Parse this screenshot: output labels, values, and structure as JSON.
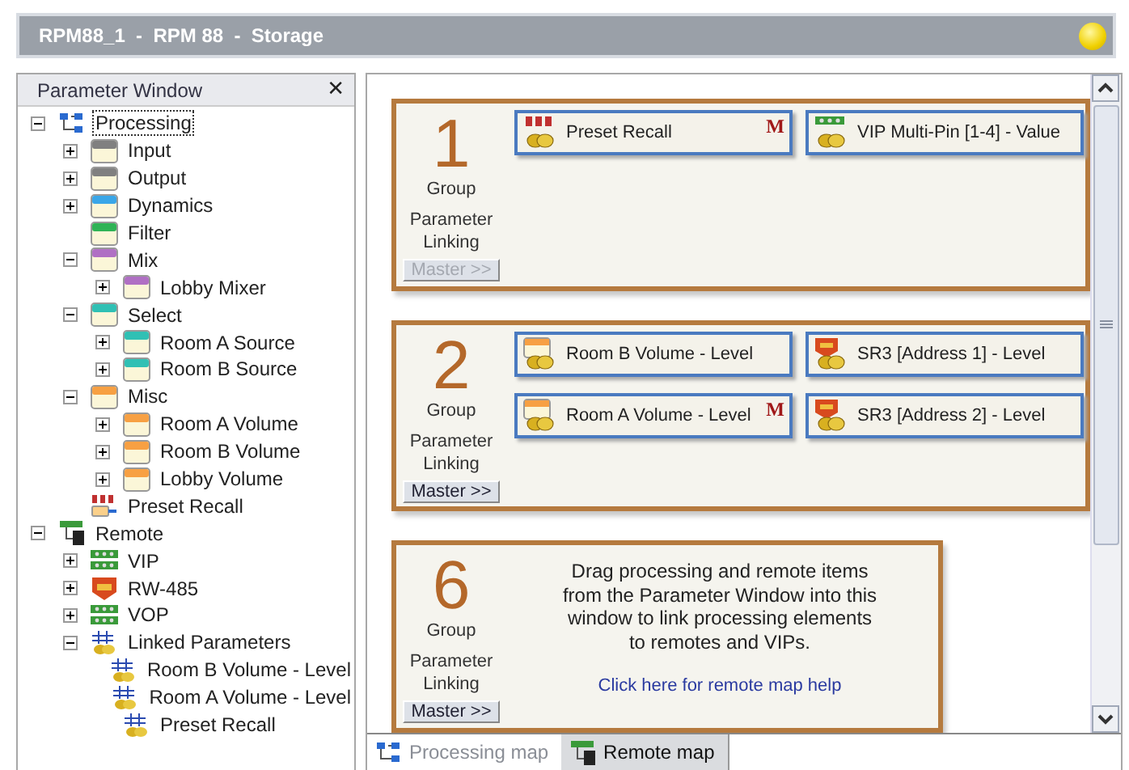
{
  "window": {
    "title": "RPM88_1  -  RPM 88  -  Storage"
  },
  "parameter_window": {
    "title": "Parameter Window",
    "close": "✕",
    "tree": [
      {
        "label": "Processing",
        "kind": "processing",
        "expanded": true,
        "selected": true,
        "children": [
          {
            "label": "Input",
            "kind": "module",
            "color": "#808080",
            "expanded": false,
            "selected": false
          },
          {
            "label": "Output",
            "kind": "module",
            "color": "#808080",
            "expanded": false,
            "selected": false
          },
          {
            "label": "Dynamics",
            "kind": "module",
            "color": "#3aa6e8",
            "expanded": false,
            "selected": false
          },
          {
            "label": "Filter",
            "kind": "module",
            "color": "#2fb356",
            "selected": false
          },
          {
            "label": "Mix",
            "kind": "module",
            "color": "#b070c4",
            "expanded": true,
            "selected": false,
            "children": [
              {
                "label": "Lobby Mixer",
                "kind": "module",
                "color": "#b070c4",
                "expanded": false,
                "selected": false
              }
            ]
          },
          {
            "label": "Select",
            "kind": "module",
            "color": "#30c0b4",
            "expanded": true,
            "selected": false,
            "children": [
              {
                "label": "Room A Source",
                "kind": "module",
                "color": "#30c0b4",
                "expanded": false,
                "selected": false
              },
              {
                "label": "Room B Source",
                "kind": "module",
                "color": "#30c0b4",
                "expanded": false,
                "selected": false
              }
            ]
          },
          {
            "label": "Misc",
            "kind": "module",
            "color": "#f7a043",
            "expanded": true,
            "selected": false,
            "children": [
              {
                "label": "Room A Volume",
                "kind": "module",
                "color": "#f7a043",
                "expanded": false,
                "selected": false
              },
              {
                "label": "Room B Volume",
                "kind": "module",
                "color": "#f7a043",
                "expanded": false,
                "selected": false
              },
              {
                "label": "Lobby Volume",
                "kind": "module",
                "color": "#f7a043",
                "expanded": false,
                "selected": false
              }
            ]
          },
          {
            "label": "Preset Recall",
            "kind": "preset",
            "selected": false
          }
        ]
      },
      {
        "label": "Remote",
        "kind": "remote",
        "expanded": true,
        "selected": false,
        "children": [
          {
            "label": "VIP",
            "kind": "vip",
            "expanded": false,
            "selected": false
          },
          {
            "label": "RW-485",
            "kind": "sr",
            "expanded": false,
            "selected": false
          },
          {
            "label": "VOP",
            "kind": "vip",
            "expanded": false,
            "selected": false
          },
          {
            "label": "Linked Parameters",
            "kind": "linked",
            "expanded": true,
            "selected": false,
            "children": [
              {
                "label": "Room B Volume - Level",
                "kind": "linked",
                "selected": false
              },
              {
                "label": "Room A Volume - Level",
                "kind": "linked",
                "selected": false
              },
              {
                "label": "Preset Recall",
                "kind": "linked",
                "selected": false
              }
            ]
          }
        ]
      }
    ]
  },
  "groups": [
    {
      "number": "1",
      "group_label": "Group",
      "linking_label": "Parameter Linking",
      "master_button": {
        "label": "Master >>",
        "disabled": true
      },
      "items": [
        {
          "label": "Preset Recall",
          "kind": "preset",
          "master_mark": "M"
        },
        {
          "label": "VIP Multi-Pin [1-4] - Value",
          "kind": "vip"
        }
      ]
    },
    {
      "number": "2",
      "group_label": "Group",
      "linking_label": "Parameter Linking",
      "master_button": {
        "label": "Master >>",
        "disabled": false
      },
      "items": [
        {
          "label": "Room B Volume - Level",
          "kind": "module"
        },
        {
          "label": "SR3 [Address 1] - Level",
          "kind": "sr"
        },
        {
          "label": "Room A Volume - Level",
          "kind": "module",
          "master_mark": "M"
        },
        {
          "label": "SR3 [Address 2] - Level",
          "kind": "sr"
        }
      ]
    },
    {
      "number": "6",
      "group_label": "Group",
      "linking_label": "Parameter Linking",
      "master_button": {
        "label": "Master >>",
        "disabled": false
      },
      "message": "Drag processing and remote items\nfrom the Parameter Window into this\nwindow to link processing elements\nto remotes and VIPs.",
      "help_link": "Click here for remote map help"
    }
  ],
  "tabs": [
    {
      "label": "Processing map",
      "kind": "processing",
      "selected": false
    },
    {
      "label": "Remote map",
      "kind": "remote",
      "selected": true
    }
  ]
}
